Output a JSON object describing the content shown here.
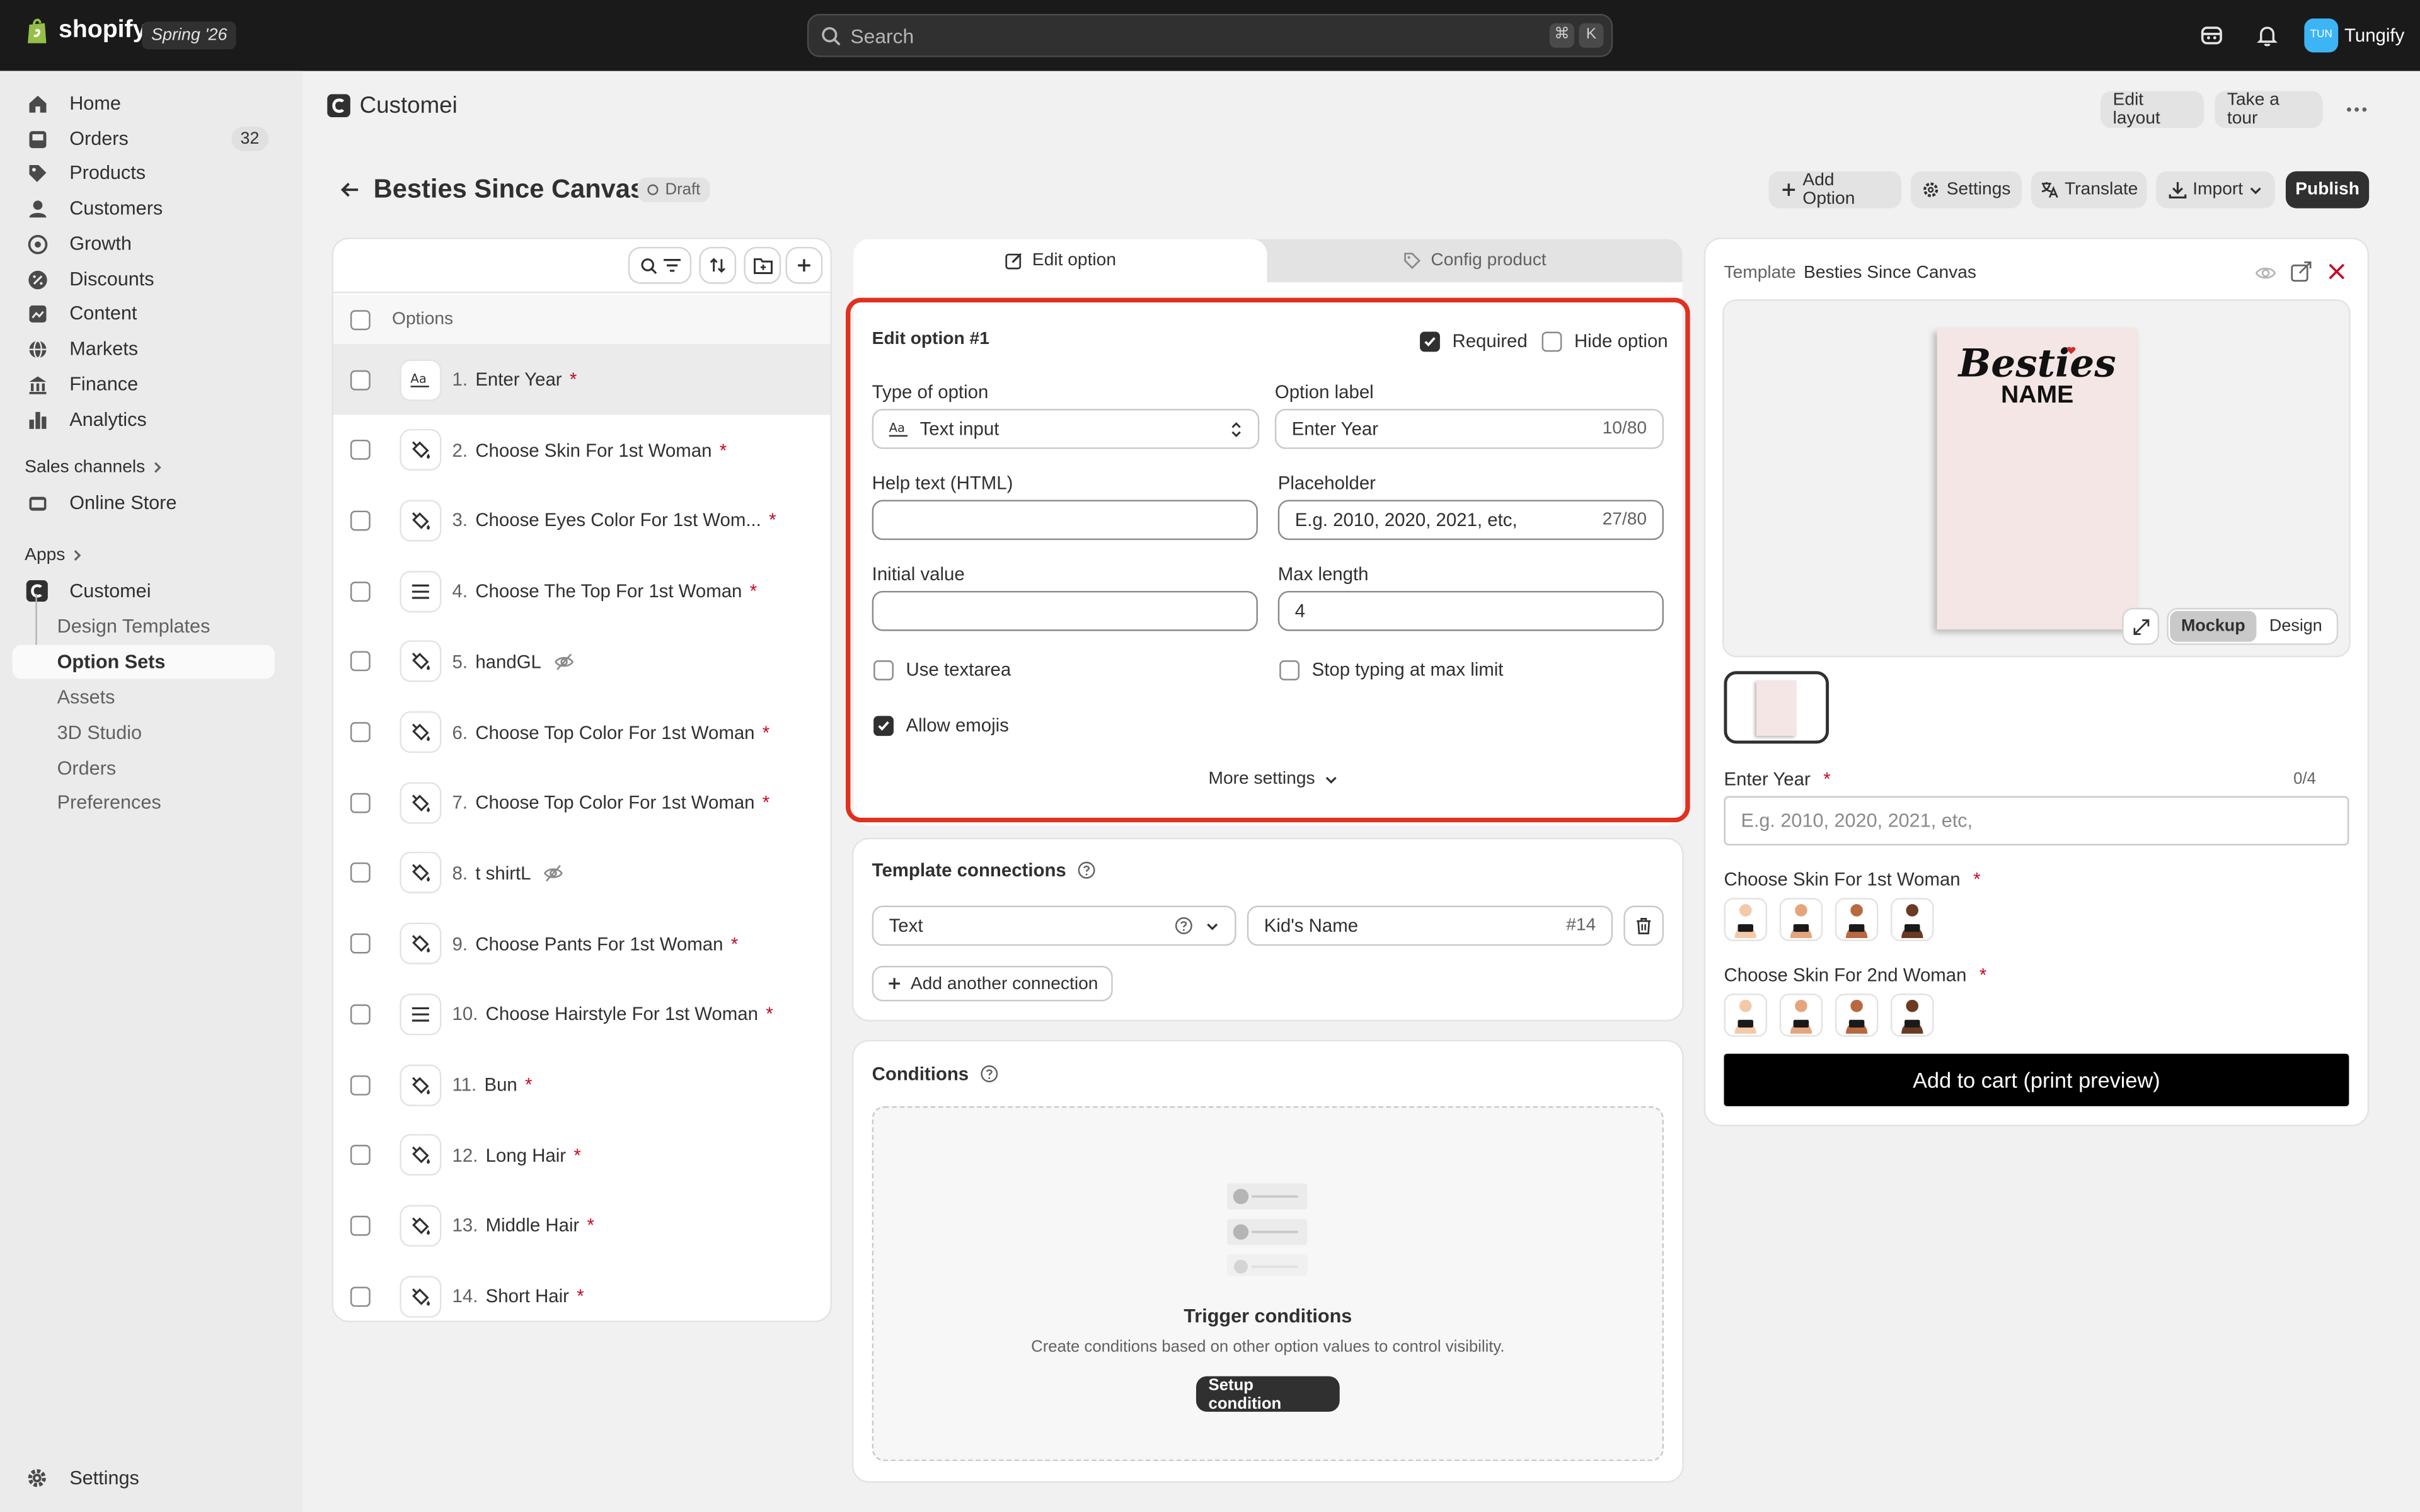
{
  "topbar": {
    "brand": "shopify",
    "edition": "Spring '26",
    "search_placeholder": "Search",
    "kbd1": "⌘",
    "kbd2": "K",
    "avatar_initials": "TUN",
    "user_name": "Tungify"
  },
  "sidebar": {
    "items": [
      {
        "label": "Home"
      },
      {
        "label": "Orders",
        "count": "32"
      },
      {
        "label": "Products"
      },
      {
        "label": "Customers"
      },
      {
        "label": "Growth"
      },
      {
        "label": "Discounts"
      },
      {
        "label": "Content"
      },
      {
        "label": "Markets"
      },
      {
        "label": "Finance"
      },
      {
        "label": "Analytics"
      }
    ],
    "sales_channels_label": "Sales channels",
    "online_store": "Online Store",
    "apps_label": "Apps",
    "app_name": "Customei",
    "app_subitems": [
      "Design Templates",
      "Option Sets",
      "Assets",
      "3D Studio",
      "Orders",
      "Preferences"
    ],
    "settings": "Settings"
  },
  "header": {
    "app_title": "Customei",
    "edit_layout": "Edit layout",
    "take_tour": "Take a tour",
    "page_title": "Besties Since Canvas",
    "status": "Draft",
    "add_option": "Add Option",
    "settings": "Settings",
    "translate": "Translate",
    "import": "Import",
    "publish": "Publish"
  },
  "options_list": {
    "header": "Options",
    "items": [
      {
        "num": "1.",
        "label": "Enter Year",
        "required": "*",
        "icon": "text-icon"
      },
      {
        "num": "2.",
        "label": "Choose Skin For 1st Woman",
        "required": "*",
        "icon": "paint-bucket-icon"
      },
      {
        "num": "3.",
        "label": "Choose Eyes Color For 1st Wom...",
        "required": "*",
        "icon": "paint-bucket-icon"
      },
      {
        "num": "4.",
        "label": "Choose The Top For 1st Woman",
        "required": "*",
        "icon": "list-icon"
      },
      {
        "num": "5.",
        "label": "handGL",
        "required": "",
        "icon": "paint-bucket-icon",
        "hidden": true
      },
      {
        "num": "6.",
        "label": "Choose Top Color For 1st Woman",
        "required": "*",
        "icon": "paint-bucket-icon"
      },
      {
        "num": "7.",
        "label": "Choose Top Color For 1st Woman",
        "required": "*",
        "icon": "paint-bucket-icon"
      },
      {
        "num": "8.",
        "label": "t shirtL",
        "required": "",
        "icon": "paint-bucket-icon",
        "hidden": true
      },
      {
        "num": "9.",
        "label": "Choose Pants For 1st Woman",
        "required": "*",
        "icon": "paint-bucket-icon"
      },
      {
        "num": "10.",
        "label": "Choose Hairstyle For 1st Woman",
        "required": "*",
        "icon": "list-icon"
      },
      {
        "num": "11.",
        "label": "Bun",
        "required": "*",
        "icon": "paint-bucket-icon"
      },
      {
        "num": "12.",
        "label": "Long Hair",
        "required": "*",
        "icon": "paint-bucket-icon"
      },
      {
        "num": "13.",
        "label": "Middle Hair",
        "required": "*",
        "icon": "paint-bucket-icon"
      },
      {
        "num": "14.",
        "label": "Short Hair",
        "required": "*",
        "icon": "paint-bucket-icon"
      }
    ]
  },
  "editor": {
    "tab_edit": "Edit option",
    "tab_config": "Config product",
    "heading": "Edit option #1",
    "required_label": "Required",
    "required_checked": true,
    "hide_label": "Hide option",
    "hide_checked": false,
    "type_label": "Type of option",
    "type_value": "Text input",
    "option_label_label": "Option label",
    "option_label_value": "Enter Year",
    "option_label_count": "10/80",
    "help_label": "Help text (HTML)",
    "help_value": "",
    "placeholder_label": "Placeholder",
    "placeholder_value": "E.g. 2010, 2020, 2021, etc,",
    "placeholder_count": "27/80",
    "initial_label": "Initial value",
    "initial_value": "",
    "maxlen_label": "Max length",
    "maxlen_value": "4",
    "use_textarea": "Use textarea",
    "stop_typing": "Stop typing at max limit",
    "allow_emojis": "Allow emojis",
    "allow_emojis_checked": true,
    "more_settings": "More settings",
    "highlight_color": "#e0301e"
  },
  "connections": {
    "title": "Template connections",
    "type_value": "Text",
    "target_value": "Kid's Name",
    "target_id": "#14",
    "add_button": "Add another connection"
  },
  "conditions": {
    "title": "Conditions",
    "empty_title": "Trigger conditions",
    "empty_desc": "Create conditions based on other option values to control visibility.",
    "setup_button": "Setup condition"
  },
  "preview": {
    "template_label": "Template",
    "template_name": "Besties Since Canvas",
    "canvas_title": "Besties",
    "canvas_subtitle": "NAME",
    "mode_mockup": "Mockup",
    "mode_design": "Design",
    "field_label": "Enter Year",
    "field_required": "*",
    "field_count": "0/4",
    "field_placeholder": "E.g. 2010, 2020, 2021, etc,",
    "skin1_label": "Choose Skin For 1st Woman",
    "skin2_label": "Choose Skin For 2nd Woman",
    "skin_tones": [
      "#f3c9a8",
      "#e5a57c",
      "#b8693f",
      "#6b3a22"
    ],
    "add_to_cart": "Add to cart (print preview)"
  }
}
